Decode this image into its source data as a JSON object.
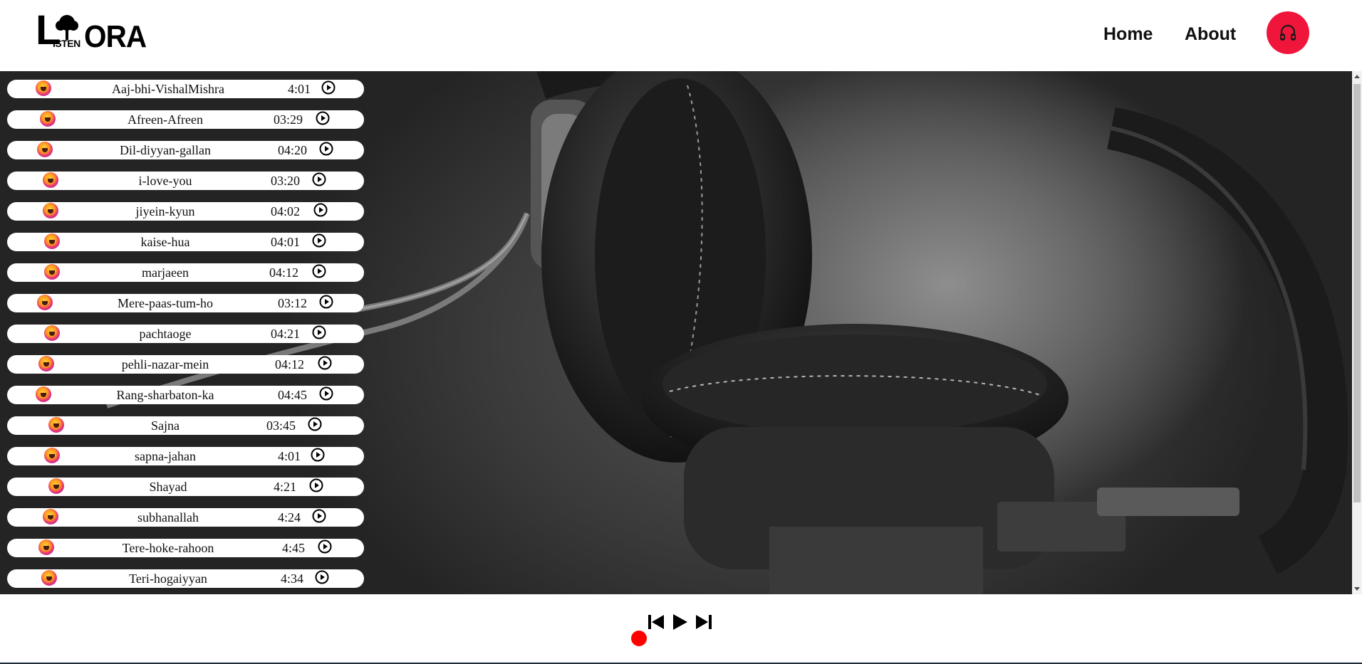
{
  "brand": {
    "logo_l": "L",
    "logo_isten": "ISTEN",
    "logo_ora": "ORA"
  },
  "nav": {
    "home": "Home",
    "about": "About"
  },
  "avatar": {
    "icon": "headphones-icon",
    "color": "#f0163b"
  },
  "playlist": [
    {
      "name": "Aaj-bhi-VishalMishra",
      "duration": "4:01"
    },
    {
      "name": "Afreen-Afreen",
      "duration": "03:29"
    },
    {
      "name": "Dil-diyyan-gallan",
      "duration": "04:20"
    },
    {
      "name": "i-love-you",
      "duration": "03:20"
    },
    {
      "name": "jiyein-kyun",
      "duration": "04:02"
    },
    {
      "name": "kaise-hua",
      "duration": "04:01"
    },
    {
      "name": "marjaeen",
      "duration": "04:12"
    },
    {
      "name": "Mere-paas-tum-ho",
      "duration": "03:12"
    },
    {
      "name": "pachtaoge",
      "duration": "04:21"
    },
    {
      "name": "pehli-nazar-mein",
      "duration": "04:12"
    },
    {
      "name": "Rang-sharbaton-ka",
      "duration": "04:45"
    },
    {
      "name": "Sajna",
      "duration": "03:45"
    },
    {
      "name": "sapna-jahan",
      "duration": "4:01"
    },
    {
      "name": "Shayad",
      "duration": "4:21"
    },
    {
      "name": "subhanallah",
      "duration": "4:24"
    },
    {
      "name": "Tere-hoke-rahoon",
      "duration": "4:45"
    },
    {
      "name": "Teri-hogaiyyan",
      "duration": "4:34"
    }
  ],
  "player": {
    "controls": [
      "previous-track-icon",
      "play-icon",
      "next-track-icon"
    ],
    "progress": 0,
    "progress_color": "#ff0000"
  }
}
